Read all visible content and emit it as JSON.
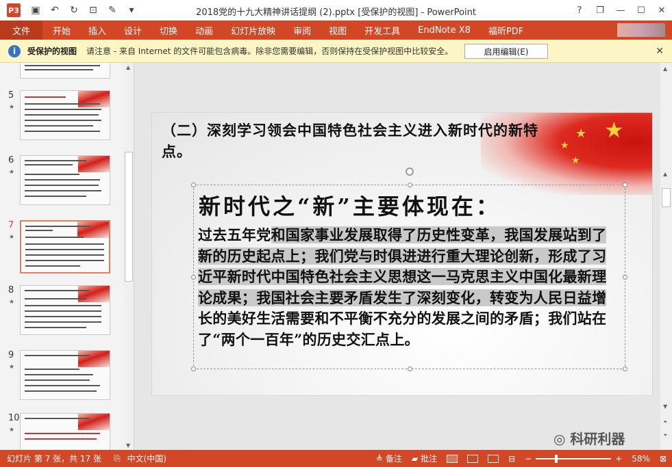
{
  "window": {
    "title": "2018党的十九大精神讲话提纲 (2).pptx [受保护的视图] - PowerPoint",
    "app_icon": "P3",
    "controls": [
      "?",
      "❐",
      "—",
      "☐",
      "✕"
    ]
  },
  "qat": [
    "save-icon",
    "undo-icon",
    "redo-icon",
    "present-icon",
    "pen-icon",
    "customize-icon"
  ],
  "ribbon": {
    "file_tab": "文件",
    "tabs": [
      "开始",
      "插入",
      "设计",
      "切换",
      "动画",
      "幻灯片放映",
      "审阅",
      "视图",
      "开发工具",
      "EndNote X8",
      "福昕PDF"
    ]
  },
  "protected_view": {
    "title": "受保护的视图",
    "message": "请注意 - 来自 Internet 的文件可能包含病毒。除非您需要编辑，否则保持在受保护视图中比较安全。",
    "enable_button": "启用编辑(E)"
  },
  "thumbnails": [
    {
      "number": "5",
      "star": "★"
    },
    {
      "number": "6",
      "star": "★"
    },
    {
      "number": "7",
      "star": "★",
      "active": true
    },
    {
      "number": "8",
      "star": "★"
    },
    {
      "number": "9",
      "star": "★"
    },
    {
      "number": "10",
      "star": "★"
    }
  ],
  "slide": {
    "title": "（二）深刻学习领会中国特色社会主义进入新时代的新特点。",
    "box_heading": "新时代之“新”主要体现在：",
    "body_plain_start": "过去五年党",
    "body_highlighted": "和国家事业发展取得了历史性变革，我国发展站到了新的历史起点上；我们党与时俱进进行重大理论创新，形成了习近平新时代中国特色社会主义思想这一马克思主义中国化最新理论成果；我国社会主要矛盾发生了深刻变化，转变为人民日益增",
    "body_plain_end": "长的美好生活需要和不平衡不充分的发展之间的矛盾；我们站在了“两个一百年”的历史交汇点上。"
  },
  "status": {
    "slide_info": "幻灯片 第 7 张，共 17 张",
    "language": "中文(中国)",
    "notes": "备注",
    "comments": "批注",
    "zoom": "58%"
  },
  "watermark": "科研利器"
}
